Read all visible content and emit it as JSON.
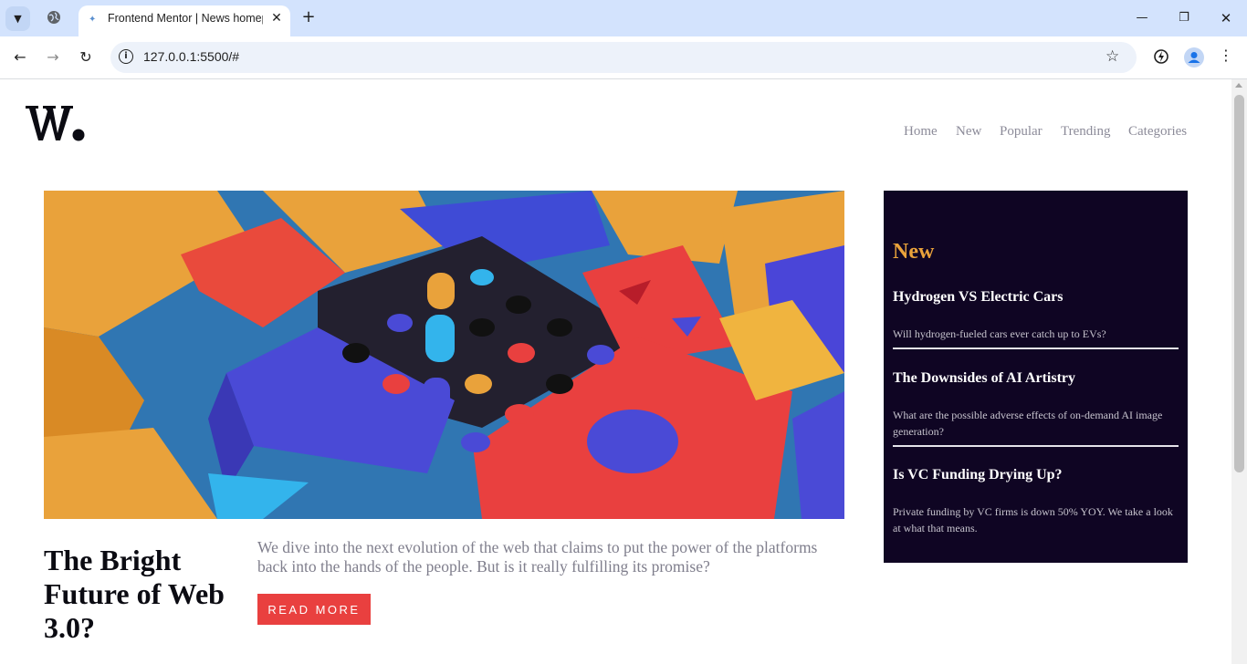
{
  "browser": {
    "tab_title": "Frontend Mentor | News homepage",
    "url": "127.0.0.1:5500/#",
    "tab_favicon": "frontend-mentor-icon",
    "icons": [
      "tab-menu-icon",
      "globe-icon",
      "close-icon",
      "new-tab-icon",
      "minimize-icon",
      "restore-icon",
      "window-close-icon",
      "back-icon",
      "forward-icon",
      "reload-icon",
      "info-icon",
      "star-icon",
      "extension-icon",
      "profile-icon",
      "menu-icon"
    ]
  },
  "site": {
    "logo_text": "W.",
    "nav": [
      "Home",
      "New",
      "Popular",
      "Trending",
      "Categories"
    ]
  },
  "hero": {
    "image_alt": "colorful 3D blocks",
    "headline": "The Bright Future of Web 3.0?",
    "description": "We dive into the next evolution of the web that claims to put the power of the platforms back into the hands of the people. But is it really fulfilling its promise?",
    "cta": "READ MORE"
  },
  "sidebar": {
    "title": "New",
    "items": [
      {
        "title": "Hydrogen VS Electric Cars",
        "text": "Will hydrogen-fueled cars ever catch up to EVs?"
      },
      {
        "title": "The Downsides of AI Artistry",
        "text": "What are the possible adverse effects of on-demand AI image generation?"
      },
      {
        "title": "Is VC Funding Drying Up?",
        "text": "Private funding by VC firms is down 50% YOY. We take a look at what that means."
      }
    ]
  },
  "colors": {
    "accent_red": "#e9403f",
    "accent_orange": "#e9a23b",
    "sidebar_bg": "#0f0523",
    "text_dark": "#0b0b12",
    "text_grey": "#7f7e8c"
  }
}
